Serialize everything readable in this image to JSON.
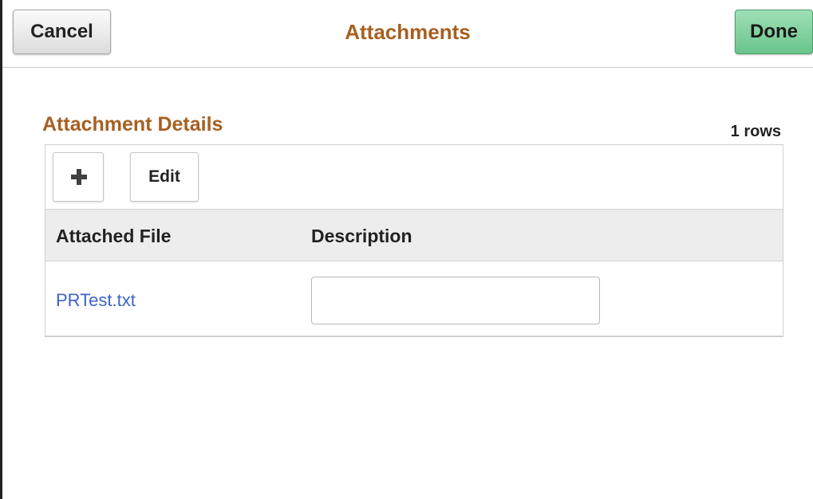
{
  "header": {
    "title": "Attachments",
    "cancel_label": "Cancel",
    "done_label": "Done"
  },
  "section": {
    "title": "Attachment Details",
    "row_count": "1 rows"
  },
  "toolbar": {
    "add_icon": "plus-icon",
    "edit_label": "Edit"
  },
  "grid": {
    "columns": [
      "Attached File",
      "Description"
    ],
    "rows": [
      {
        "attached_file": "PRTest.txt",
        "description": ""
      }
    ]
  },
  "colors": {
    "accent_title": "#a75f21",
    "link": "#3c63c9",
    "done_button": "#69c48b"
  }
}
